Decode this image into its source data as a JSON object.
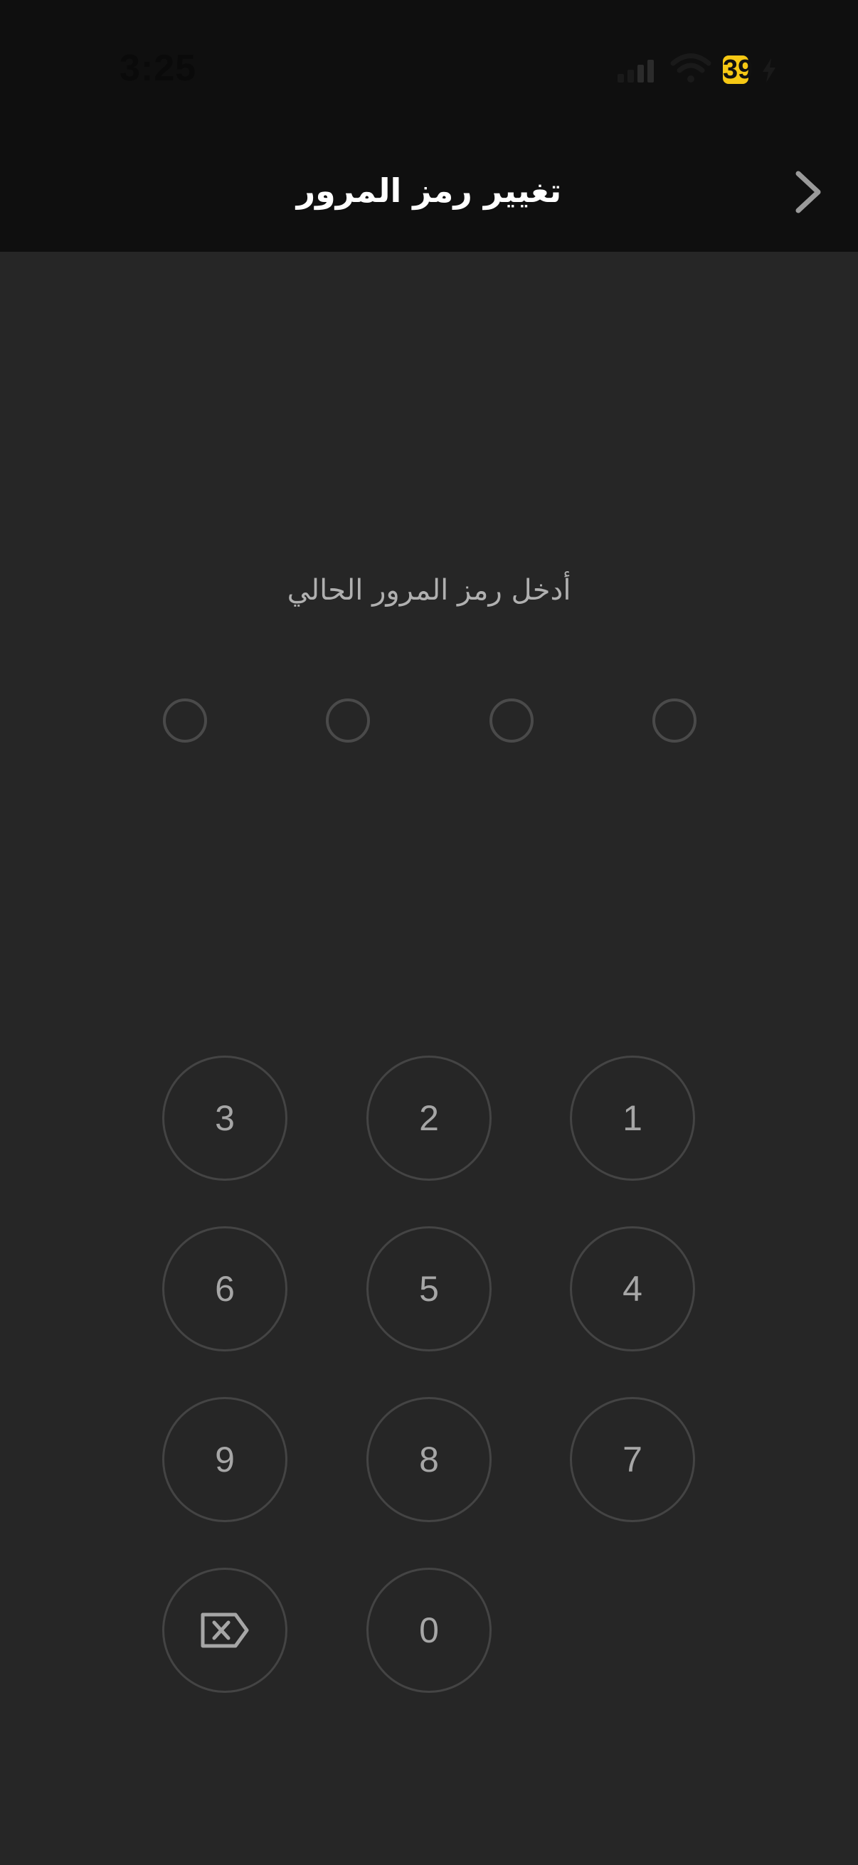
{
  "status_bar": {
    "time": "3:25",
    "battery_level": "39",
    "battery_color": "#f6c814",
    "icons": [
      "signal-icon",
      "wifi-icon",
      "battery-icon",
      "charging-bolt-icon"
    ]
  },
  "header": {
    "title": "تغيير رمز المرور",
    "back_icon": "chevron-right-icon"
  },
  "passcode": {
    "prompt": "أدخل رمز المرور الحالي",
    "length": 4,
    "entered": 0
  },
  "keypad": {
    "keys": [
      "1",
      "2",
      "3",
      "4",
      "5",
      "6",
      "7",
      "8",
      "9",
      "0"
    ],
    "delete_icon": "backspace-icon"
  },
  "colors": {
    "background": "#262626",
    "header_background": "#0f0f0f",
    "key_border": "#444444",
    "key_text": "#a6a6a6"
  }
}
